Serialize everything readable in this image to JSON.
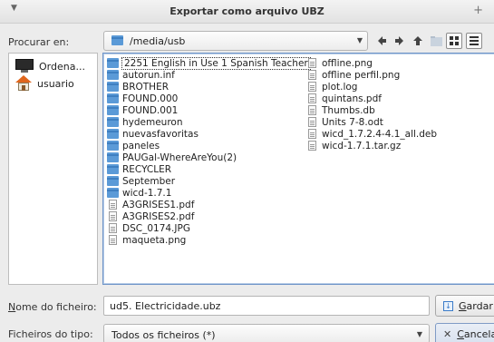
{
  "window": {
    "title": "Exportar como arquivo UBZ"
  },
  "toolbar": {
    "look_in_label": "Procurar en:",
    "path": "/media/usb"
  },
  "places": [
    {
      "label": "Ordena...",
      "icon": "computer-icon"
    },
    {
      "label": "usuario",
      "icon": "home-icon"
    }
  ],
  "files": {
    "column1": [
      {
        "name": "2251 English in Use 1 Spanish Teacher",
        "type": "folder"
      },
      {
        "name": "autorun.inf",
        "type": "folder"
      },
      {
        "name": "BROTHER",
        "type": "folder"
      },
      {
        "name": "FOUND.000",
        "type": "folder"
      },
      {
        "name": "FOUND.001",
        "type": "folder"
      },
      {
        "name": "hydemeuron",
        "type": "folder"
      },
      {
        "name": "nuevasfavoritas",
        "type": "folder"
      },
      {
        "name": "paneles",
        "type": "folder"
      },
      {
        "name": "PAUGal-WhereAreYou(2)",
        "type": "folder"
      },
      {
        "name": "RECYCLER",
        "type": "folder"
      },
      {
        "name": "September",
        "type": "folder"
      },
      {
        "name": "wicd-1.7.1",
        "type": "folder"
      },
      {
        "name": "A3GRISES1.pdf",
        "type": "file"
      },
      {
        "name": "A3GRISES2.pdf",
        "type": "file"
      },
      {
        "name": "DSC_0174.JPG",
        "type": "file"
      },
      {
        "name": "maqueta.png",
        "type": "file"
      }
    ],
    "column2": [
      {
        "name": "offline.png",
        "type": "file"
      },
      {
        "name": "offline perfil.png",
        "type": "file"
      },
      {
        "name": "plot.log",
        "type": "file"
      },
      {
        "name": "quintans.pdf",
        "type": "file"
      },
      {
        "name": "Thumbs.db",
        "type": "file"
      },
      {
        "name": "Units 7-8.odt",
        "type": "file"
      },
      {
        "name": "wicd_1.7.2.4-4.1_all.deb",
        "type": "file"
      },
      {
        "name": "wicd-1.7.1.tar.gz",
        "type": "file"
      }
    ]
  },
  "filename": {
    "label_first": "N",
    "label_rest": "ome do ficheiro:",
    "value": "ud5. Electricidade.ubz"
  },
  "filetype": {
    "label": "Ficheiros do tipo:",
    "value": "Todos os ficheiros (*)"
  },
  "buttons": {
    "save_first": "G",
    "save_rest": "ardar",
    "cancel_first": "C",
    "cancel_rest": "ancelar"
  },
  "colors": {
    "selection_border": "#6f95c8",
    "folder": "#5b9ad7"
  }
}
